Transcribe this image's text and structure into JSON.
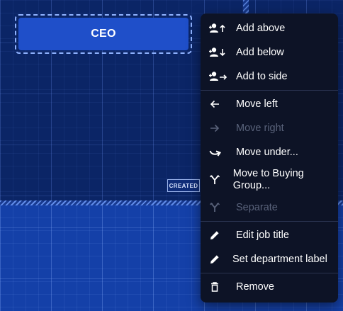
{
  "org_chart": {
    "node": {
      "title": "CEO"
    },
    "badge": {
      "label": "CREATED"
    }
  },
  "context_menu": {
    "groups": [
      [
        {
          "label": "Add above",
          "icon": "person-add-up-icon",
          "disabled": false
        },
        {
          "label": "Add below",
          "icon": "person-add-down-icon",
          "disabled": false
        },
        {
          "label": "Add to side",
          "icon": "person-add-side-icon",
          "disabled": false
        }
      ],
      [
        {
          "label": "Move left",
          "icon": "arrow-left-icon",
          "disabled": false
        },
        {
          "label": "Move right",
          "icon": "arrow-right-icon",
          "disabled": true
        },
        {
          "label": "Move under...",
          "icon": "arrow-curve-under-icon",
          "disabled": false
        },
        {
          "label": "Move to Buying Group...",
          "icon": "fork-icon",
          "disabled": false
        },
        {
          "label": "Separate",
          "icon": "fork-icon",
          "disabled": true
        }
      ],
      [
        {
          "label": "Edit job title",
          "icon": "pencil-icon",
          "disabled": false
        },
        {
          "label": "Set department label",
          "icon": "pencil-icon",
          "disabled": false
        }
      ],
      [
        {
          "label": "Remove",
          "icon": "trash-icon",
          "disabled": false
        }
      ]
    ]
  },
  "colors": {
    "canvas_bg": "#0b2566",
    "lower_band_bg": "#1440a8",
    "node_bg": "#1f4fc9",
    "menu_bg": "#0d1326",
    "menu_text": "#ffffff",
    "menu_text_disabled": "#59627a"
  }
}
